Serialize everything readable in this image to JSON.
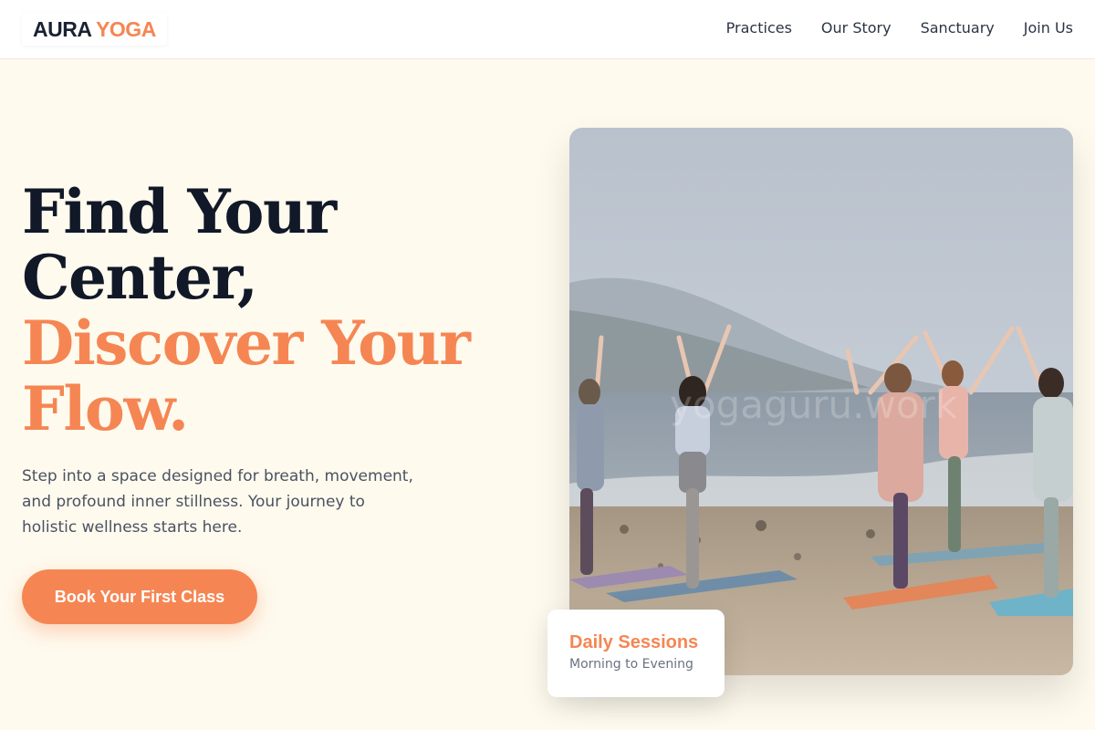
{
  "brand": {
    "name_part1": "AURA",
    "name_part2": "YOGA",
    "accent_color": "#f58653",
    "dark_color": "#111827",
    "background_color": "#fefaee"
  },
  "nav": {
    "items": [
      {
        "label": "Practices"
      },
      {
        "label": "Our Story"
      },
      {
        "label": "Sanctuary"
      },
      {
        "label": "Join Us"
      }
    ]
  },
  "hero": {
    "headline_line1": "Find Your",
    "headline_line2": "Center,",
    "headline_line3": "Discover Your",
    "headline_line4": "Flow.",
    "subtitle": "Step into a space designed for breath, movement, and profound inner stillness. Your journey to holistic wellness starts here.",
    "cta_label": "Book Your First Class"
  },
  "photo": {
    "watermark": "yogaguru.work"
  },
  "badge": {
    "title": "Daily Sessions",
    "subtitle": "Morning to Evening"
  }
}
